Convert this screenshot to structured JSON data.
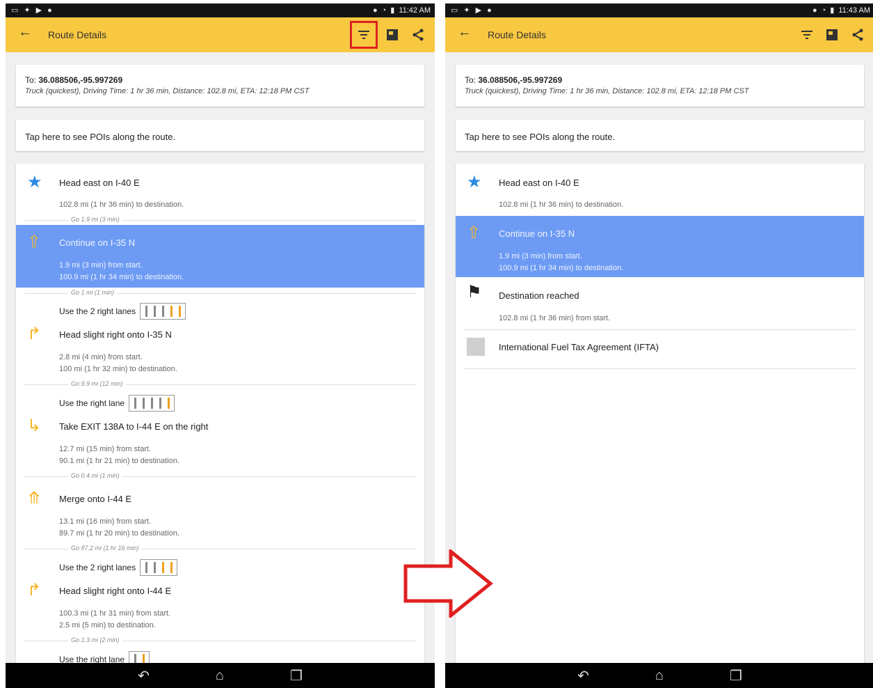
{
  "left": {
    "status": {
      "time": "11:42 AM"
    },
    "appbar": {
      "back_icon": "arrow-left-icon",
      "title": "Route Details"
    },
    "summary": {
      "to_label": "To: ",
      "to_value": "36.088506,-95.997269",
      "detail": "Truck (quickest), Driving Time: 1 hr 36 min, Distance: 102.8 mi, ETA: 12:18 PM CST"
    },
    "poi_text": "Tap here to see POIs along the route.",
    "steps": [
      {
        "icon": "star-icon",
        "text": "Head east on I-40 E",
        "d1": "102.8 mi (1 hr 36 min) to destination.",
        "go": "Go 1.9 mi (3 min)"
      },
      {
        "icon": "straight-arrow-icon",
        "text": "Continue on I-35 N",
        "d1": "1.9 mi (3 min) from start.",
        "d2": "100.9 mi (1 hr 34 min) to destination.",
        "go": "Go 1 mi (1 min)",
        "lanes": "Use the 2 right lanes"
      },
      {
        "icon": "slight-right-icon",
        "text": "Head slight right onto I-35 N",
        "d1": "2.8 mi (4 min) from start.",
        "d2": "100 mi (1 hr 32 min) to destination.",
        "go": "Go 9.9 mi (12 min)",
        "lanes": "Use the right lane"
      },
      {
        "icon": "exit-right-icon",
        "text": "Take EXIT 138A to I-44 E on the right",
        "d1": "12.7 mi (15 min) from start.",
        "d2": "90.1 mi (1 hr 21 min) to destination.",
        "go": "Go 0.4 mi (1 min)"
      },
      {
        "icon": "merge-icon",
        "text": "Merge onto I-44 E",
        "d1": "13.1 mi (16 min) from start.",
        "d2": "89.7 mi (1 hr 20 min) to destination.",
        "go": "Go 87.2 mi (1 hr 16 min)",
        "lanes": "Use the 2 right lanes"
      },
      {
        "icon": "slight-right-icon",
        "text": "Head slight right onto I-44 E",
        "d1": "100.3 mi (1 hr 31 min) from start.",
        "d2": "2.5 mi (5 min) to destination.",
        "go": "Go 1.3 mi (2 min)",
        "lanes": "Use the right lane"
      }
    ]
  },
  "right": {
    "status": {
      "time": "11:43 AM"
    },
    "appbar": {
      "title": "Route Details"
    },
    "summary": {
      "to_label": "To: ",
      "to_value": "36.088506,-95.997269",
      "detail": "Truck (quickest), Driving Time: 1 hr 36 min, Distance: 102.8 mi, ETA: 12:18 PM CST"
    },
    "poi_text": "Tap here to see POIs along the route.",
    "steps": [
      {
        "icon": "star-icon",
        "text": "Head east on I-40 E",
        "d1": "102.8 mi (1 hr 36 min) to destination."
      },
      {
        "icon": "straight-arrow-icon",
        "text": "Continue on I-35 N",
        "d1": "1.9 mi (3 min) from start.",
        "d2": "100.9 mi (1 hr 34 min) to destination."
      },
      {
        "icon": "checkered-flag-icon",
        "text": "Destination reached",
        "d1": "102.8 mi (1 hr 36 min) from start."
      },
      {
        "icon": "ifta-icon",
        "text": "International Fuel Tax Agreement (IFTA)"
      }
    ]
  },
  "colors": {
    "appbar": "#f9c841",
    "selected": "#6d9bf3",
    "highlight": "#e02020"
  }
}
